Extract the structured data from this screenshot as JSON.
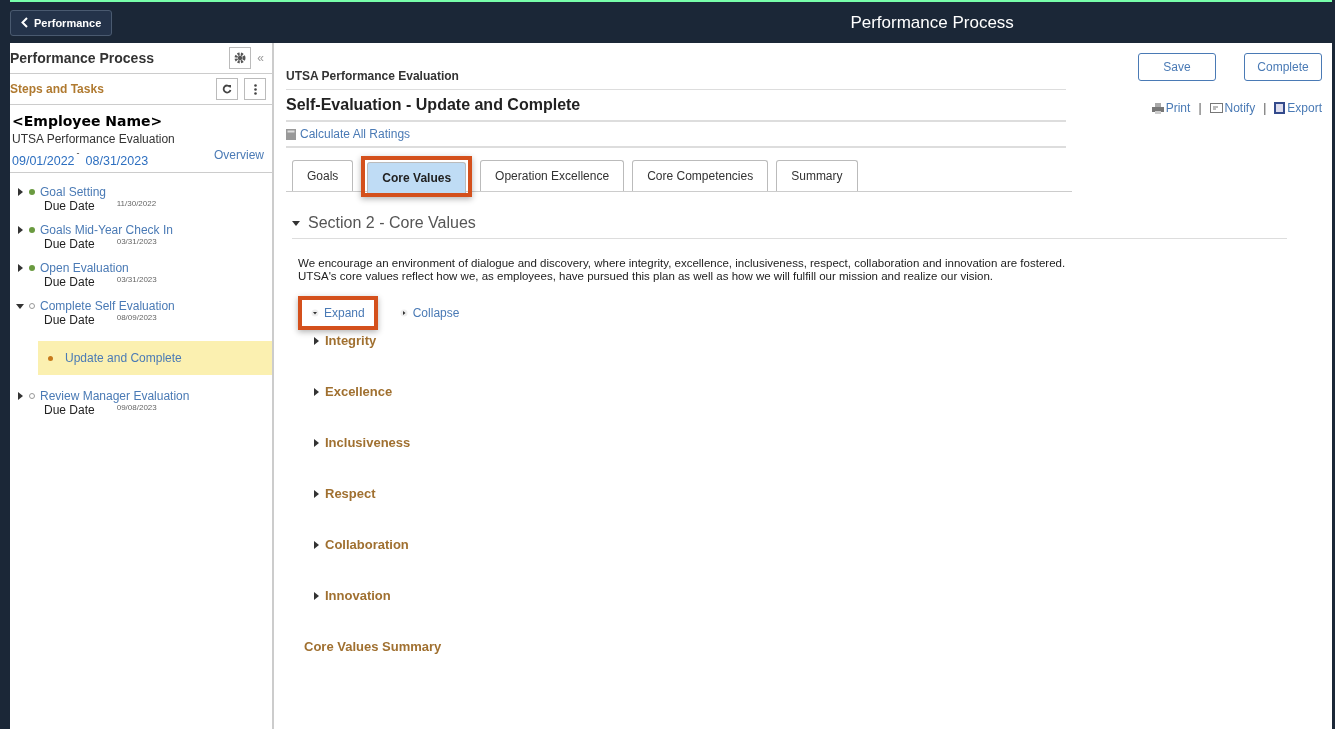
{
  "top_bar": {
    "back_button": "Performance",
    "title": "Performance Process"
  },
  "sidebar": {
    "title": "Performance Process",
    "subtitle": "Steps and Tasks",
    "collapse": "«",
    "employee": "<Employee Name>",
    "evaluation": "UTSA Performance Evaluation",
    "start_date": "09/01/2022",
    "date_separator": "-",
    "end_date": "08/31/2023",
    "overview": "Overview",
    "steps": [
      {
        "title": "Goal Setting",
        "due_label": "Due Date",
        "due_date": "11/30/2022",
        "complete": true,
        "expanded": false
      },
      {
        "title": "Goals Mid-Year Check In",
        "due_label": "Due Date",
        "due_date": "03/31/2023",
        "complete": true,
        "expanded": false
      },
      {
        "title": "Open Evaluation",
        "due_label": "Due Date",
        "due_date": "03/31/2023",
        "complete": true,
        "expanded": false
      },
      {
        "title": "Complete Self Evaluation",
        "due_label": "Due Date",
        "due_date": "08/09/2023",
        "complete": false,
        "expanded": true,
        "children": [
          {
            "title": "Update and Complete",
            "selected": true
          }
        ]
      },
      {
        "title": "Review Manager Evaluation",
        "due_label": "Due Date",
        "due_date": "09/08/2023",
        "complete": false,
        "expanded": false
      }
    ]
  },
  "main": {
    "form_name": "UTSA Performance Evaluation",
    "page_title": "Self-Evaluation - Update and Complete",
    "calculate": "Calculate All Ratings",
    "buttons": [
      "Save",
      "Complete"
    ],
    "actions": [
      {
        "label": "Print",
        "kind": "print"
      },
      {
        "label": "Notify",
        "kind": "notify"
      },
      {
        "label": "Export",
        "kind": "export"
      }
    ],
    "action_separator": "|",
    "tabs": [
      {
        "label": "Goals",
        "selected": false,
        "highlighted": false
      },
      {
        "label": "Core Values",
        "selected": true,
        "highlighted": true
      },
      {
        "label": "Operation Excellence",
        "selected": false,
        "highlighted": false
      },
      {
        "label": "Core Competencies",
        "selected": false,
        "highlighted": false
      },
      {
        "label": "Summary",
        "selected": false,
        "highlighted": false
      }
    ],
    "section_title": "Section 2 - Core Values",
    "section_expanded": true,
    "description": "We encourage an environment of dialogue and discovery, where integrity, excellence, inclusiveness, respect, collaboration and innovation are fostered. UTSA's core values reflect how we, as employees, have pursued this plan as well as how we will fulfill our mission and realize our vision.",
    "links": [
      {
        "label": "Expand",
        "kind": "expand",
        "highlighted": true
      },
      {
        "label": "Collapse",
        "kind": "collapse",
        "highlighted": false
      }
    ],
    "values": [
      {
        "label": "Integrity",
        "expanded": false
      },
      {
        "label": "Excellence",
        "expanded": false
      },
      {
        "label": "Inclusiveness",
        "expanded": false
      },
      {
        "label": "Respect",
        "expanded": false
      },
      {
        "label": "Collaboration",
        "expanded": false
      },
      {
        "label": "Innovation",
        "expanded": false
      }
    ],
    "summary_title": "Core Values Summary"
  }
}
